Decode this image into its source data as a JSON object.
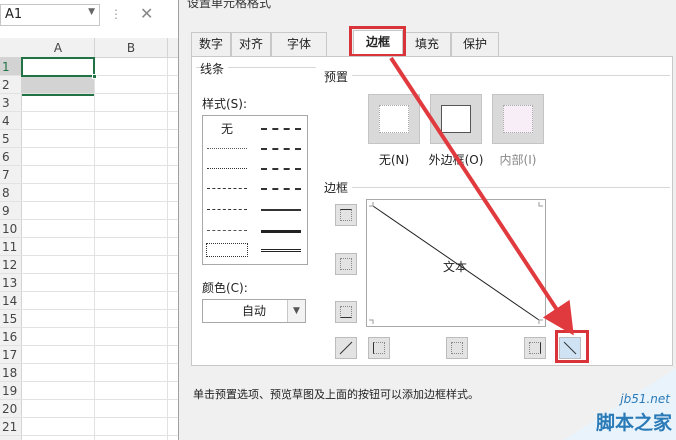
{
  "sheet": {
    "name_box": "A1",
    "columns": [
      "A",
      "B"
    ],
    "rows": [
      "1",
      "2",
      "3",
      "4",
      "5",
      "6",
      "7",
      "8",
      "9",
      "10",
      "11",
      "12",
      "13",
      "14",
      "15",
      "16",
      "17",
      "18",
      "19",
      "20",
      "21"
    ]
  },
  "dialog": {
    "title": "设置单元格格式",
    "tabs": [
      "数字",
      "对齐",
      "字体",
      "边框",
      "填充",
      "保护"
    ],
    "active_tab": "边框",
    "line_group": "线条",
    "style_label": "样式(S):",
    "line_none": "无",
    "color_label": "颜色(C):",
    "color_value": "自动",
    "preset_group": "预置",
    "presets": [
      "无(N)",
      "外边框(O)",
      "内部(I)"
    ],
    "border_group": "边框",
    "preview_text": "文本",
    "hint": "单击预置选项、预览草图及上面的按钮可以添加边框样式。"
  },
  "watermark": {
    "url": "jb51.net",
    "text": "脚本之家"
  },
  "colors": {
    "accent": "#217346",
    "highlight": "#d9343a"
  }
}
